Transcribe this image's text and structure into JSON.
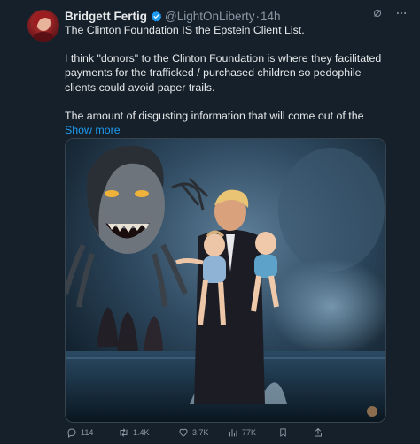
{
  "author": {
    "name": "Bridgett Fertig",
    "handle": "@LightOnLiberty",
    "separator": "·",
    "time": "14h"
  },
  "tweet": {
    "paragraph1": "The Clinton Foundation IS the Epstein Client List.",
    "paragraph2": "I think \"donors\" to the Clinton Foundation is where they facilitated payments for the trafficked / purchased children so pedophile clients could avoid paper trails.",
    "paragraph3": "The amount of disgusting information that will come out of the",
    "show_more": "Show more"
  },
  "actions": {
    "replies": "114",
    "reposts": "1.4K",
    "likes": "3.7K",
    "views": "77K"
  },
  "icons": {
    "verified": "verified-badge-icon",
    "grok": "grok-icon",
    "more": "more-icon",
    "reply": "reply-icon",
    "repost": "repost-icon",
    "like": "heart-icon",
    "views": "views-icon",
    "bookmark": "bookmark-icon",
    "share": "share-icon"
  },
  "colors": {
    "background": "#15202b",
    "text": "#e7e9ea",
    "muted": "#8b98a5",
    "accent": "#1d9bf0"
  }
}
